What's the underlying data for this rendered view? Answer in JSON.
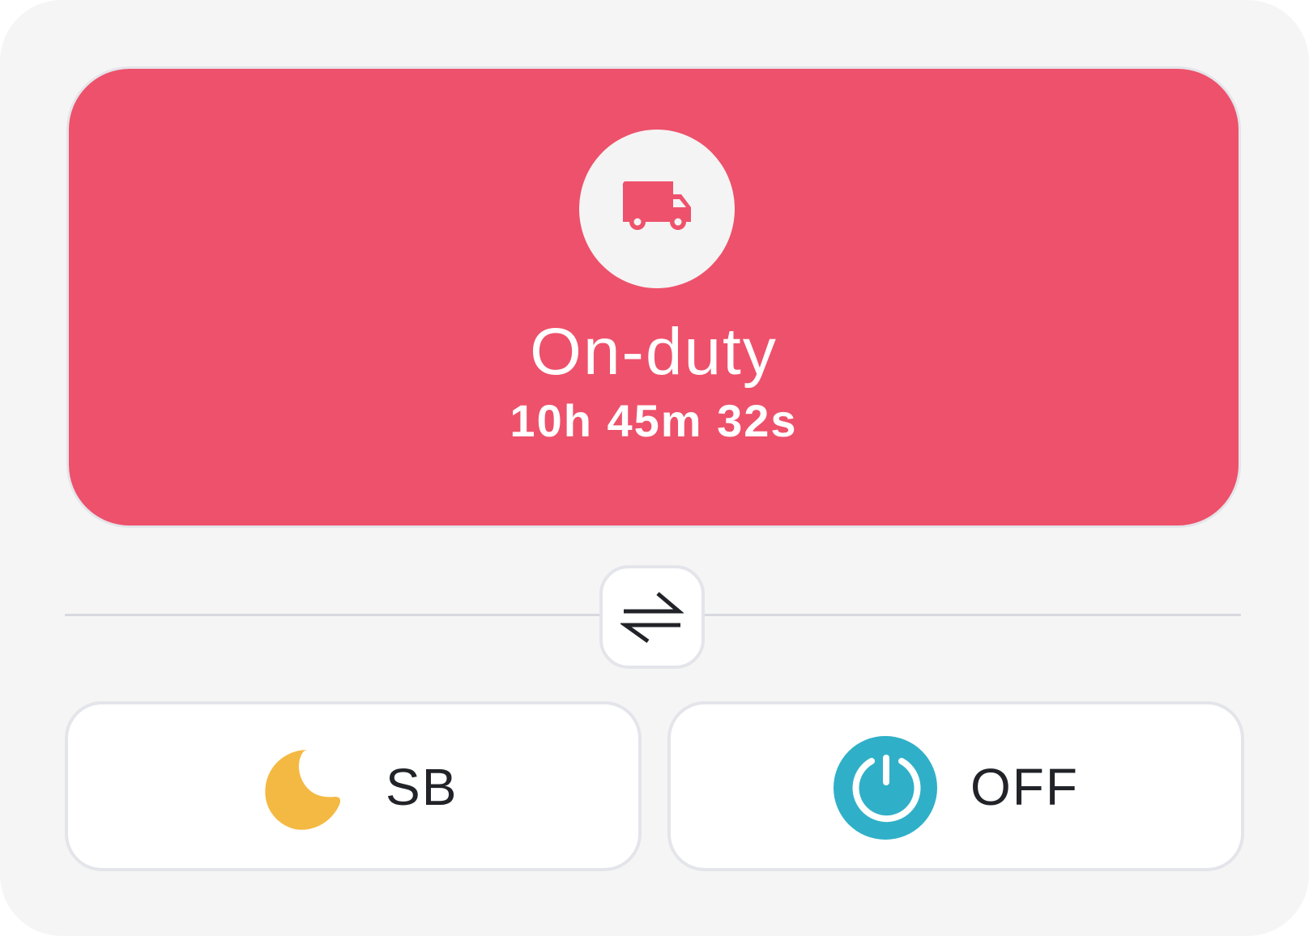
{
  "status": {
    "icon": "truck-icon",
    "title": "On-duty",
    "timer": "10h 45m 32s",
    "color": "#ee516b"
  },
  "switch": {
    "icon": "swap-arrows-icon"
  },
  "options": [
    {
      "icon": "moon-icon",
      "label": "SB",
      "icon_color": "#f4b942"
    },
    {
      "icon": "power-icon",
      "label": "OFF",
      "icon_color": "#2fb0c8"
    }
  ]
}
